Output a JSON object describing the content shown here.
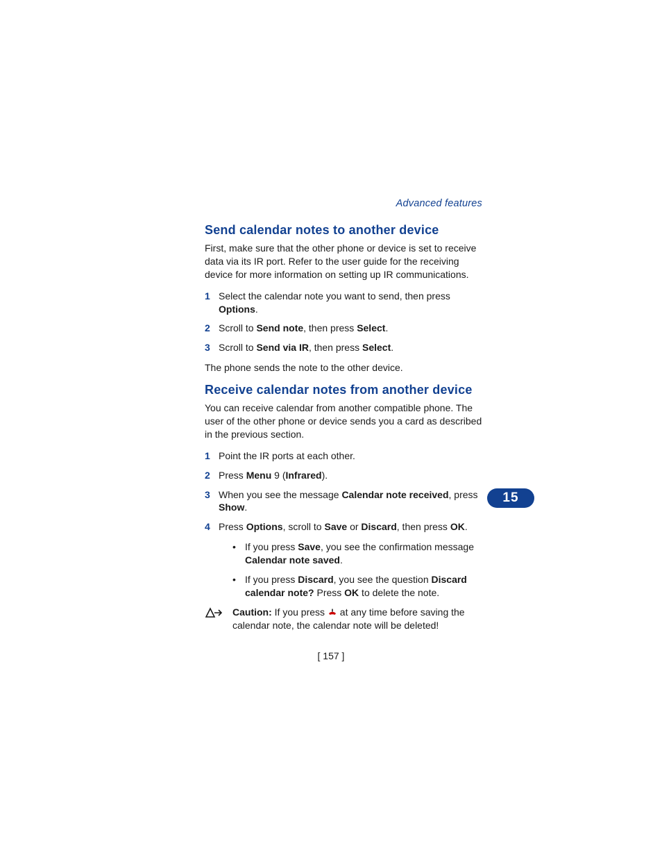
{
  "running_head": "Advanced features",
  "chapter_number": "15",
  "page_number": "[ 157 ]",
  "section1": {
    "title": "Send calendar notes to another device",
    "intro": "First, make sure that the other phone or device is set to receive data via its IR port. Refer to the user guide for the receiving device for more information on setting up IR communications.",
    "steps": [
      {
        "n": "1",
        "pre": "Select the calendar note you want to send, then press ",
        "b1": "Options",
        "post": "."
      },
      {
        "n": "2",
        "pre": "Scroll to ",
        "b1": "Send note",
        "mid": ", then press ",
        "b2": "Select",
        "post": "."
      },
      {
        "n": "3",
        "pre": "Scroll to ",
        "b1": "Send via IR",
        "mid": ", then press ",
        "b2": "Select",
        "post": "."
      }
    ],
    "outro": "The phone sends the note to the other device."
  },
  "section2": {
    "title": "Receive calendar notes from another device",
    "intro": "You can receive calendar from another compatible phone. The user of the other phone or device sends you a card as described in the previous section.",
    "steps": [
      {
        "n": "1",
        "txt": "Point the IR ports at each other."
      },
      {
        "n": "2",
        "pre": "Press ",
        "b1": "Menu",
        "mid": " 9 (",
        "b2": "Infrared",
        "post": ")."
      },
      {
        "n": "3",
        "pre": "When you see the message ",
        "b1": "Calendar note received",
        "mid": ", press ",
        "b2": "Show",
        "post": "."
      },
      {
        "n": "4",
        "pre": "Press ",
        "b1": "Options",
        "mid": ", scroll to ",
        "b2": "Save",
        "mid2": " or ",
        "b3": "Discard",
        "mid3": ", then press ",
        "b4": "OK",
        "post": "."
      }
    ],
    "bullets": [
      {
        "pre": "If you press ",
        "b1": "Save",
        "mid": ", you see the confirmation message ",
        "b2": "Calendar note saved",
        "post": "."
      },
      {
        "pre": "If you press ",
        "b1": "Discard",
        "mid": ", you see the question ",
        "b2": "Discard calendar note?",
        "mid2": " Press ",
        "b3": "OK",
        "post": " to delete the note."
      }
    ],
    "caution": {
      "label": "Caution:",
      "pre": " If you press ",
      "post": " at any time before saving the calendar note, the calendar note will be deleted!"
    }
  }
}
